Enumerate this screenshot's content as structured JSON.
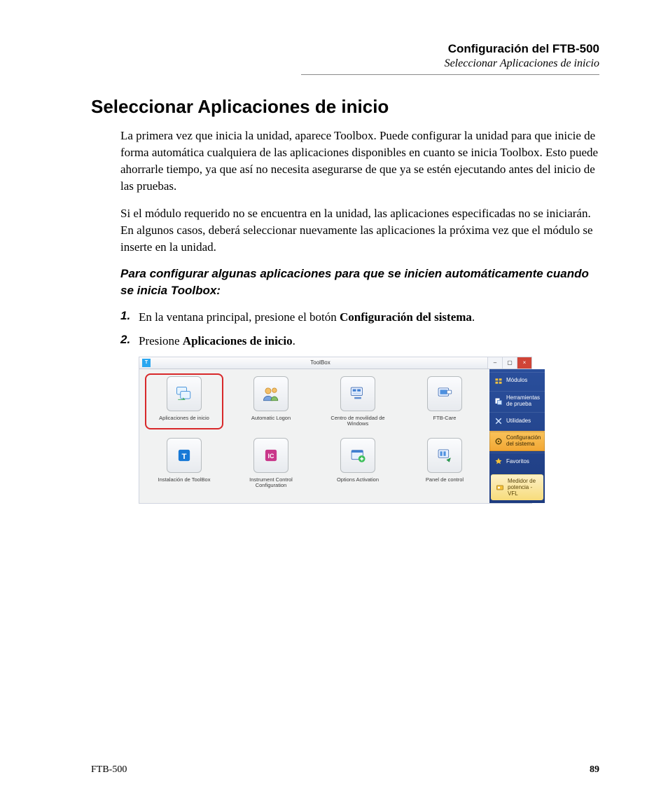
{
  "header": {
    "title": "Configuración del FTB-500",
    "subtitle": "Seleccionar Aplicaciones de inicio"
  },
  "section": {
    "title": "Seleccionar Aplicaciones de inicio",
    "p1": "La primera vez que inicia la unidad, aparece Toolbox. Puede configurar la unidad para que inicie de forma automática cualquiera de las aplicaciones disponibles en cuanto se inicia Toolbox. Esto puede ahorrarle tiempo, ya que así no necesita asegurarse de que ya se estén ejecutando antes del inicio de las pruebas.",
    "p2": "Si el módulo requerido no se encuentra en la unidad, las aplicaciones especificadas no se iniciarán. En algunos casos, deberá seleccionar nuevamente las aplicaciones la próxima vez que el módulo se inserte en la unidad.",
    "lead": "Para configurar algunas aplicaciones para que se inicien automáticamente cuando se inicia Toolbox:",
    "steps": [
      {
        "num": "1.",
        "pre": "En la ventana principal, presione el botón ",
        "bold": "Configuración del sistema",
        "post": "."
      },
      {
        "num": "2.",
        "pre": "Presione ",
        "bold": "Aplicaciones de inicio",
        "post": "."
      }
    ]
  },
  "shot": {
    "window_title": "ToolBox",
    "app_badge": "T",
    "win_buttons": {
      "min": "–",
      "max": "▢",
      "close": "×"
    },
    "grid": [
      [
        {
          "label": "Aplicaciones de inicio",
          "icon": "startup-apps",
          "highlight": true
        },
        {
          "label": "Automatic Logon",
          "icon": "user-people"
        },
        {
          "label": "Centro de movilidad de Windows",
          "icon": "mobility-center"
        },
        {
          "label": "FTB-Care",
          "icon": "ftb-care"
        }
      ],
      [
        {
          "label": "Instalación de ToolBox",
          "icon": "toolbox-install"
        },
        {
          "label": "Instrument Control Configuration",
          "icon": "instrument-control"
        },
        {
          "label": "Options Activation",
          "icon": "options-activation"
        },
        {
          "label": "Panel de control",
          "icon": "control-panel"
        }
      ]
    ],
    "sidebar": [
      {
        "label": "Módulos",
        "icon": "modules-icon"
      },
      {
        "label": "Herramientas de prueba",
        "icon": "test-tools-icon"
      },
      {
        "label": "Utilidades",
        "icon": "utilities-icon"
      },
      {
        "label": "Configuración del sistema",
        "icon": "system-config-icon",
        "active": true
      },
      {
        "label": "Favoritos",
        "icon": "favorites-icon"
      },
      {
        "label": "Medidor de potencia - VFL",
        "icon": "power-meter-icon",
        "alt": true
      }
    ]
  },
  "footer": {
    "left": "FTB-500",
    "right": "89"
  }
}
